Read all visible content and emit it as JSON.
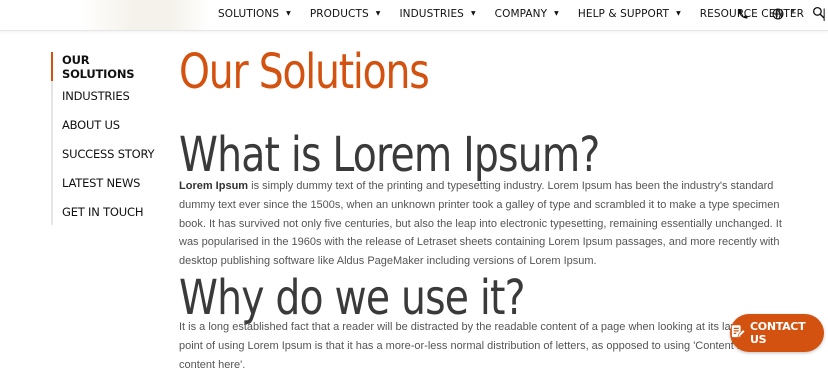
{
  "nav": {
    "items": [
      {
        "label": "SOLUTIONS",
        "caret": true
      },
      {
        "label": "PRODUCTS",
        "caret": true
      },
      {
        "label": "INDUSTRIES",
        "caret": true
      },
      {
        "label": "COMPANY",
        "caret": true
      },
      {
        "label": "HELP & SUPPORT",
        "caret": true
      },
      {
        "label": "RESOURCE CENTER",
        "caret": false
      }
    ],
    "separator": "|",
    "icons": [
      "phone-icon",
      "globe-icon",
      "search-icon"
    ]
  },
  "sidebar": {
    "items": [
      {
        "label": "OUR SOLUTIONS",
        "active": true
      },
      {
        "label": "INDUSTRIES",
        "active": false
      },
      {
        "label": "ABOUT US",
        "active": false
      },
      {
        "label": "SUCCESS STORY",
        "active": false
      },
      {
        "label": "LATEST NEWS",
        "active": false
      },
      {
        "label": "GET IN TOUCH",
        "active": false
      }
    ]
  },
  "main": {
    "title": "Our Solutions",
    "sections": [
      {
        "heading": "What is Lorem Ipsum?",
        "lead": "Lorem Ipsum",
        "body": " is simply dummy text of the printing and typesetting industry. Lorem Ipsum has been the industry's standard dummy text ever since the 1500s, when an unknown printer took a galley of type and scrambled it to make a type specimen book. It has survived not only five centuries, but also the leap into electronic typesetting, remaining essentially unchanged. It was popularised in the 1960s with the release of Letraset sheets containing Lorem Ipsum passages, and more recently with desktop publishing software like Aldus PageMaker including versions of Lorem Ipsum."
      },
      {
        "heading": "Why do we use it?",
        "body": "It is a long established fact that a reader will be distracted by the readable content of a page when looking at its layout. The point of using Lorem Ipsum is that it has a more-or-less normal distribution of letters, as opposed to using 'Content here, content here'."
      }
    ]
  },
  "contact_button": {
    "label": "CONTACT US",
    "icon": "edit-form-icon"
  },
  "colors": {
    "accent": "#d4520f",
    "heading": "#3a3a3a",
    "body_text": "#555555"
  }
}
